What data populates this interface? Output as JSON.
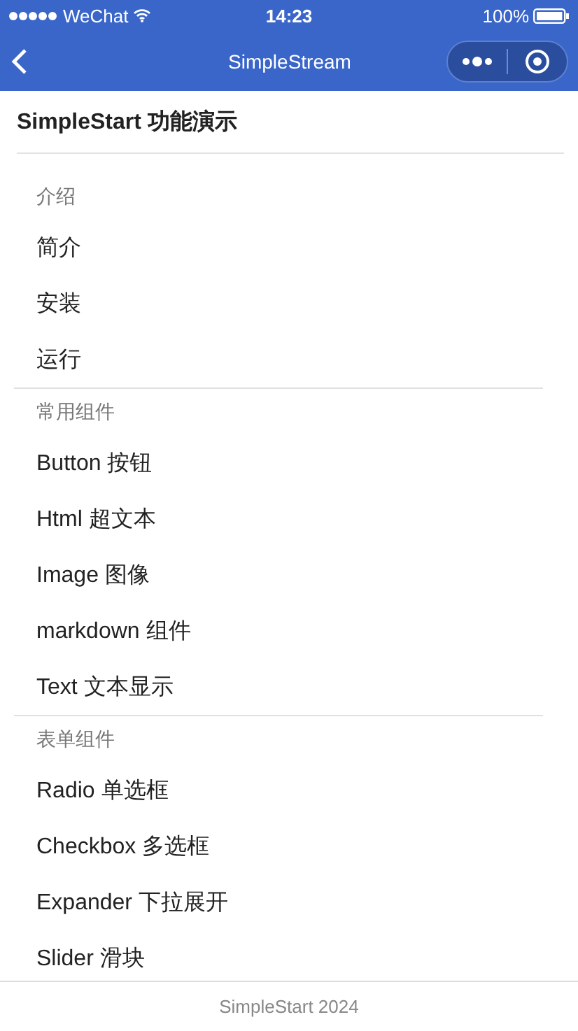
{
  "status_bar": {
    "carrier": "WeChat",
    "time": "14:23",
    "battery": "100%"
  },
  "nav_bar": {
    "title": "SimpleStream"
  },
  "page_title": "SimpleStart 功能演示",
  "sections": [
    {
      "header": "介绍",
      "items": [
        "简介",
        "安装",
        "运行"
      ]
    },
    {
      "header": "常用组件",
      "items": [
        "Button 按钮",
        "Html 超文本",
        "Image 图像",
        "markdown 组件",
        "Text 文本显示"
      ]
    },
    {
      "header": "表单组件",
      "items": [
        "Radio 单选框",
        "Checkbox 多选框",
        "Expander 下拉展开",
        "Slider 滑块"
      ]
    }
  ],
  "footer": "SimpleStart 2024"
}
